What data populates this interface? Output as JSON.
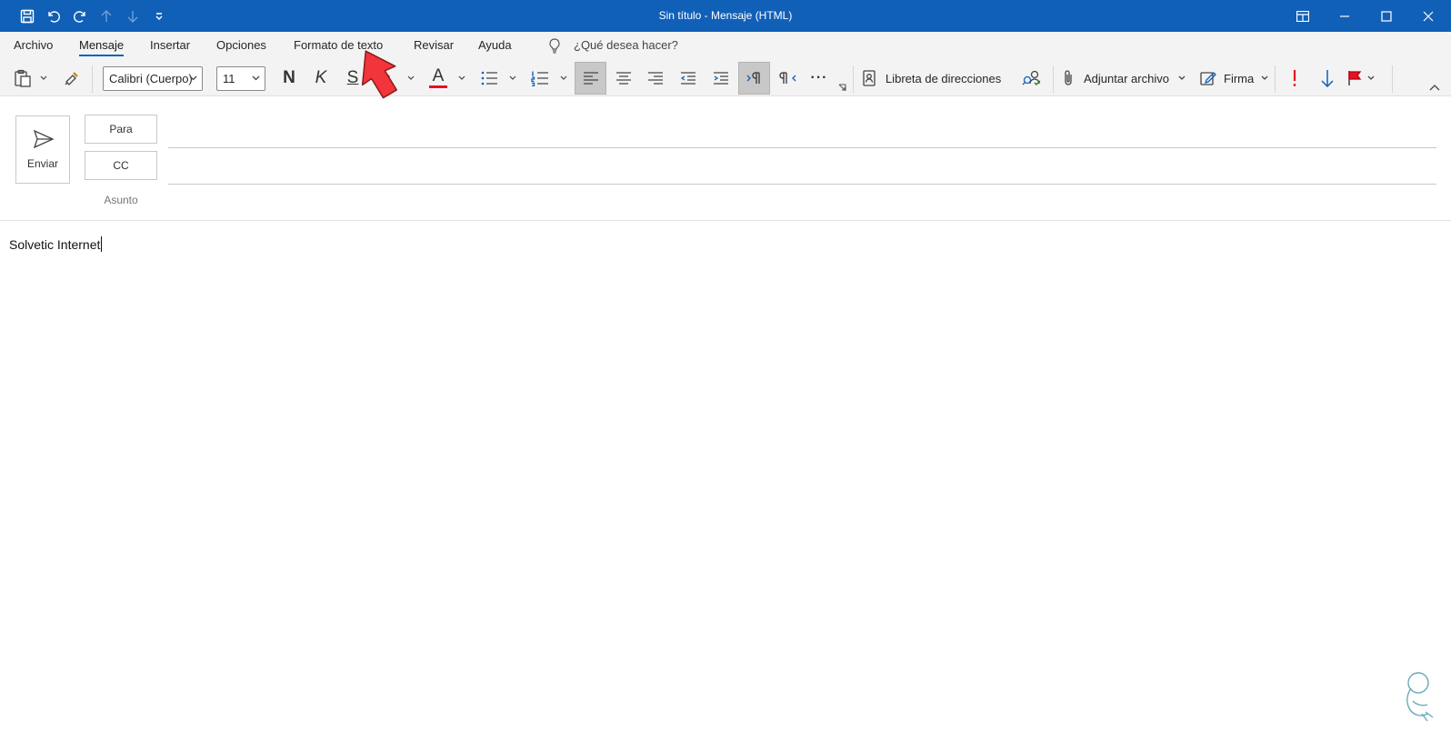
{
  "window": {
    "title": "Sin título  -  Mensaje (HTML)",
    "controls": [
      "restore-layout",
      "minimize",
      "maximize",
      "close"
    ]
  },
  "quick_access": [
    "save-icon",
    "undo-icon",
    "redo-icon",
    "up-arrow-icon",
    "down-arrow-icon",
    "customize-icon"
  ],
  "tabs": [
    "Archivo",
    "Mensaje",
    "Insertar",
    "Opciones",
    "Formato de texto",
    "Revisar",
    "Ayuda"
  ],
  "active_tab": "Mensaje",
  "tell_me": "¿Qué desea hacer?",
  "ribbon": {
    "font_name": "Calibri (Cuerpo)",
    "font_size": "11",
    "bold": "N",
    "italic": "K",
    "underline": "S",
    "font_color_letter": "A",
    "address_book": "Libreta de direcciones",
    "attach": "Adjuntar archivo",
    "signature": "Firma",
    "more": "···",
    "font_color": "#e81123",
    "importance_color": "#e81123",
    "low_importance_color": "#1160b8"
  },
  "compose": {
    "send_label": "Enviar",
    "to_label": "Para",
    "cc_label": "CC",
    "subject_label": "Asunto",
    "to_value": "",
    "cc_value": "",
    "subject_value": "",
    "body_text": "Solvetic Internet"
  },
  "colors": {
    "titlebar": "#1160b8",
    "ribbon_bg": "#f3f3f3",
    "pointer": "#f2353a"
  }
}
